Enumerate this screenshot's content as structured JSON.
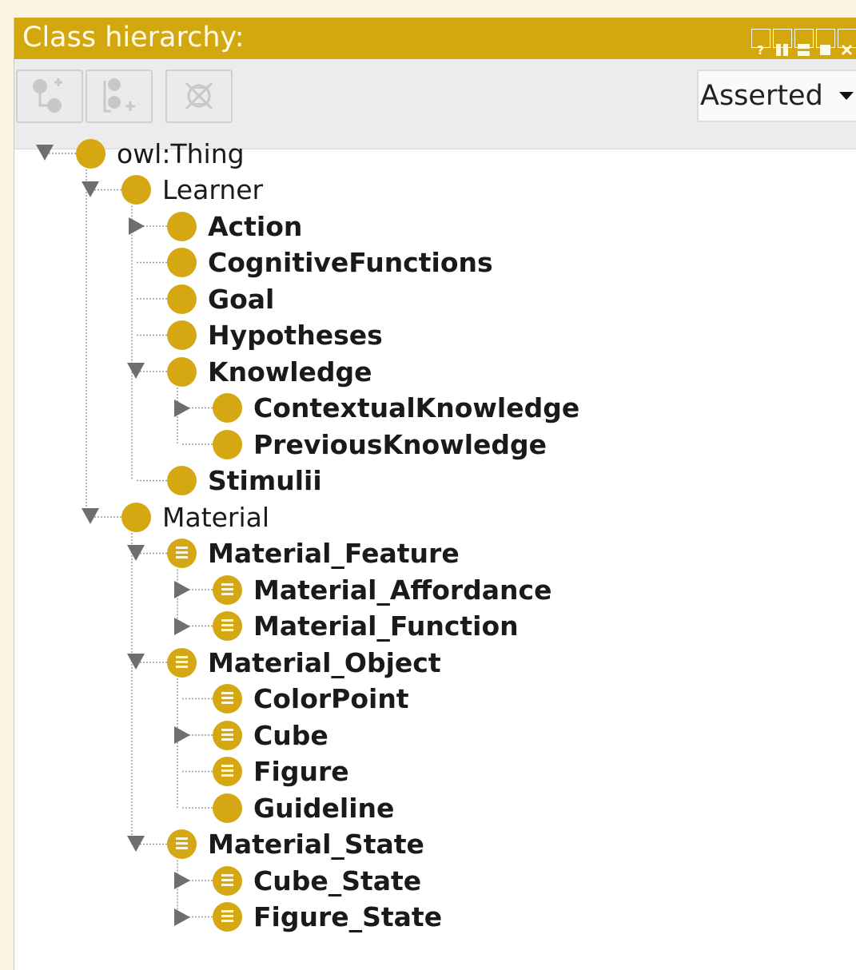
{
  "panel": {
    "title": "Class hierarchy:",
    "window_buttons": [
      "help-icon",
      "split-vertical-icon",
      "split-horizontal-icon",
      "maximize-icon",
      "close-icon"
    ],
    "colors": {
      "title_bar": "#d3a80e",
      "class_icon": "#d5a712"
    }
  },
  "toolbar": {
    "buttons": [
      "add-subclass-icon",
      "add-sibling-class-icon",
      "delete-class-icon"
    ],
    "view_select": "Asserted"
  },
  "tree": [
    {
      "label": "owl:Thing",
      "bold": false,
      "defined": false,
      "expander": "expanded"
    },
    {
      "label": "Learner",
      "bold": false,
      "defined": false,
      "expander": "expanded"
    },
    {
      "label": "Action",
      "bold": true,
      "defined": false,
      "expander": "collapsed"
    },
    {
      "label": "CognitiveFunctions",
      "bold": true,
      "defined": false,
      "expander": "leaf"
    },
    {
      "label": "Goal",
      "bold": true,
      "defined": false,
      "expander": "leaf"
    },
    {
      "label": "Hypotheses",
      "bold": true,
      "defined": false,
      "expander": "leaf"
    },
    {
      "label": "Knowledge",
      "bold": true,
      "defined": false,
      "expander": "expanded"
    },
    {
      "label": "ContextualKnowledge",
      "bold": true,
      "defined": false,
      "expander": "collapsed"
    },
    {
      "label": "PreviousKnowledge",
      "bold": true,
      "defined": false,
      "expander": "leaf"
    },
    {
      "label": "Stimulii",
      "bold": true,
      "defined": false,
      "expander": "leaf"
    },
    {
      "label": "Material",
      "bold": false,
      "defined": false,
      "expander": "expanded"
    },
    {
      "label": "Material_Feature",
      "bold": true,
      "defined": true,
      "expander": "expanded"
    },
    {
      "label": "Material_Affordance",
      "bold": true,
      "defined": true,
      "expander": "collapsed"
    },
    {
      "label": "Material_Function",
      "bold": true,
      "defined": true,
      "expander": "collapsed"
    },
    {
      "label": "Material_Object",
      "bold": true,
      "defined": true,
      "expander": "expanded"
    },
    {
      "label": "ColorPoint",
      "bold": true,
      "defined": true,
      "expander": "leaf"
    },
    {
      "label": "Cube",
      "bold": true,
      "defined": true,
      "expander": "collapsed"
    },
    {
      "label": "Figure",
      "bold": true,
      "defined": true,
      "expander": "leaf"
    },
    {
      "label": "Guideline",
      "bold": true,
      "defined": false,
      "expander": "leaf"
    },
    {
      "label": "Material_State",
      "bold": true,
      "defined": true,
      "expander": "expanded"
    },
    {
      "label": "Cube_State",
      "bold": true,
      "defined": true,
      "expander": "collapsed"
    },
    {
      "label": "Figure_State",
      "bold": true,
      "defined": true,
      "expander": "collapsed"
    }
  ]
}
